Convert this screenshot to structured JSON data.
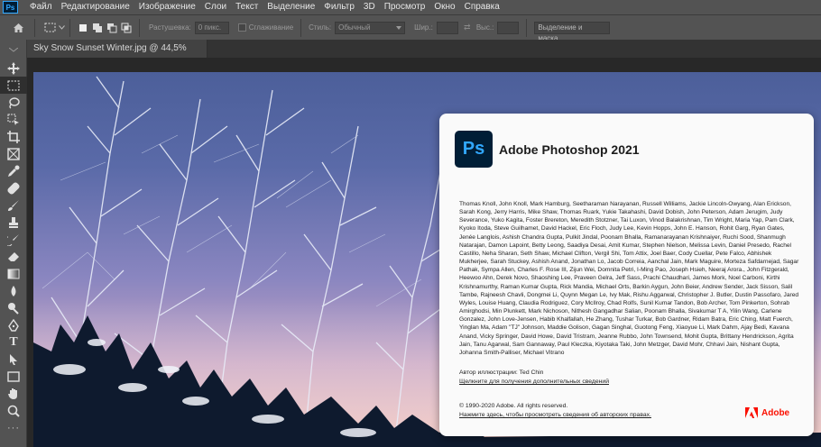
{
  "app": {
    "logo_text": "Ps"
  },
  "menu": [
    "Файл",
    "Редактирование",
    "Изображение",
    "Слои",
    "Текст",
    "Выделение",
    "Фильтр",
    "3D",
    "Просмотр",
    "Окно",
    "Справка"
  ],
  "options": {
    "feather_label": "Растушевка:",
    "feather_value": "0 пикс.",
    "antialias_label": "Сглаживание",
    "style_label": "Стиль:",
    "style_value": "Обычный",
    "width_label": "Шир.:",
    "height_label": "Выс.:",
    "select_mask_button": "Выделение и маска..."
  },
  "document": {
    "tab_title": "Sky Snow Sunset Winter.jpg @ 44,5% (RGB/8)"
  },
  "about": {
    "logo_text": "Ps",
    "title": "Adobe Photoshop 2021",
    "credits": "Thomas Knoll, John Knoll, Mark Hamburg, Seetharaman Narayanan, Russell Williams, Jackie Lincoln-Owyang, Alan Erickson, Sarah Kong, Jerry Harris, Mike Shaw, Thomas Ruark, Yukie Takahashi, David Dobish, John Peterson, Adam Jerugim, Judy Severance, Yuko Kagita, Foster Brereton, Meredith Stotzner, Tai Luxon, Vinod Balakrishnan, Tim Wright, Maria Yap, Pam Clark, Kyoko Itoda, Steve Guilhamet, David Hackel, Eric Floch, Judy Lee, Kevin Hopps, John E. Hanson, Rohit Garg, Ryan Gates, Jenée Langlois, Ashish Chandra Gupta, Pulkit Jindal, Poonam Bhalla, Ramanarayanan Krishnaiyer, Ruchi Sood, Shanmugh Natarajan, Damon Lapoint, Betty Leong, Saadiya Desai, Amit Kumar, Stephen Nielson, Melissa Levin, Daniel Presedo, Rachel Castillo, Neha Sharan, Seth Shaw, Michael Clifton, Vergil Shi, Tom Attix, Joel Baer, Cody Cuellar, Pete Falco, Abhishek Mukherjee, Sarah Stuckey, Ashish Anand, Jonathan Lo, Jacob Correia, Aanchal Jain, Mark Maguire, Morteza Safdarnejad, Sagar Pathak, Sympa Allen, Charles F. Rose III, Zijun Wei, Domnita Petri, I-Ming Pao, Joseph Hsieh, Neeraj Arora., John Fitzgerald, Heewoo Ahn, Derek Novo, Shaoshing Lee, Praveen Gelra, Jeff Sass, Prachi Chaudhari, James Mork, Noel Carboni, Kirthi Krishnamurthy, Raman Kumar Gupta, Rick Mandia, Michael Orts, Barkin Aygun, John Beier, Andrew Sender, Jack Sisson, Salil Tambe, Rajneesh Chavli, Dongmei Li, Quynn Megan Le, Ivy Mak, Rishu Aggarwal, Christopher J. Butler, Dustin Passofaro, Jared Wyles, Louise Huang, Claudia Rodriguez, Cory McIlroy, Chad Rolfs, Sunil Kumar Tandon, Bob Archer, Tom Pinkerton, Sohrab Amirghodsi, Min Plunkett, Mark Nichoson, Nithesh Gangadhar Salian, Poonam Bhalla, Sivakumar T A, Yilin Wang, Carlene Gonzalez, John Love-Jensen, Habib Khalfallah, He Zhang, Tushar Turkar, Bob Gardner, Ridam Batra, Eric Ching, Matt Fuerch, Yinglan Ma, Adam \"TJ\" Johnson, Maddie Golison, Gagan Singhal, Guotong Feng, Xiaoyue Li, Mark Dahm, Ajay Bedi, Kavana Anand, Vicky Springer, David Howe, David Tristram, Jeanne Rubbo, John Townsend, Mohit Gupta, Brittany Hendrickson, Agrita Jain, Tanu Agarwal, Sam Gannaway, Paul Kleczka, Kiyotaka Taki, John Metzger, David Mohr, Chhavi Jain, Nishant Gupta, Johanna Smith-Palliser, Michael Vitrano",
    "illustration_author": "Автор иллюстрации: Ted Chin",
    "more_info_link": "Щелкните для получения дополнительных сведений",
    "copyright": "© 1990-2020 Adobe. All rights reserved.",
    "legal_link": "Нажмите здесь, чтобы просмотреть сведения об авторских правах.",
    "brand": "Adobe",
    "brand_color": "#fa0f00"
  }
}
